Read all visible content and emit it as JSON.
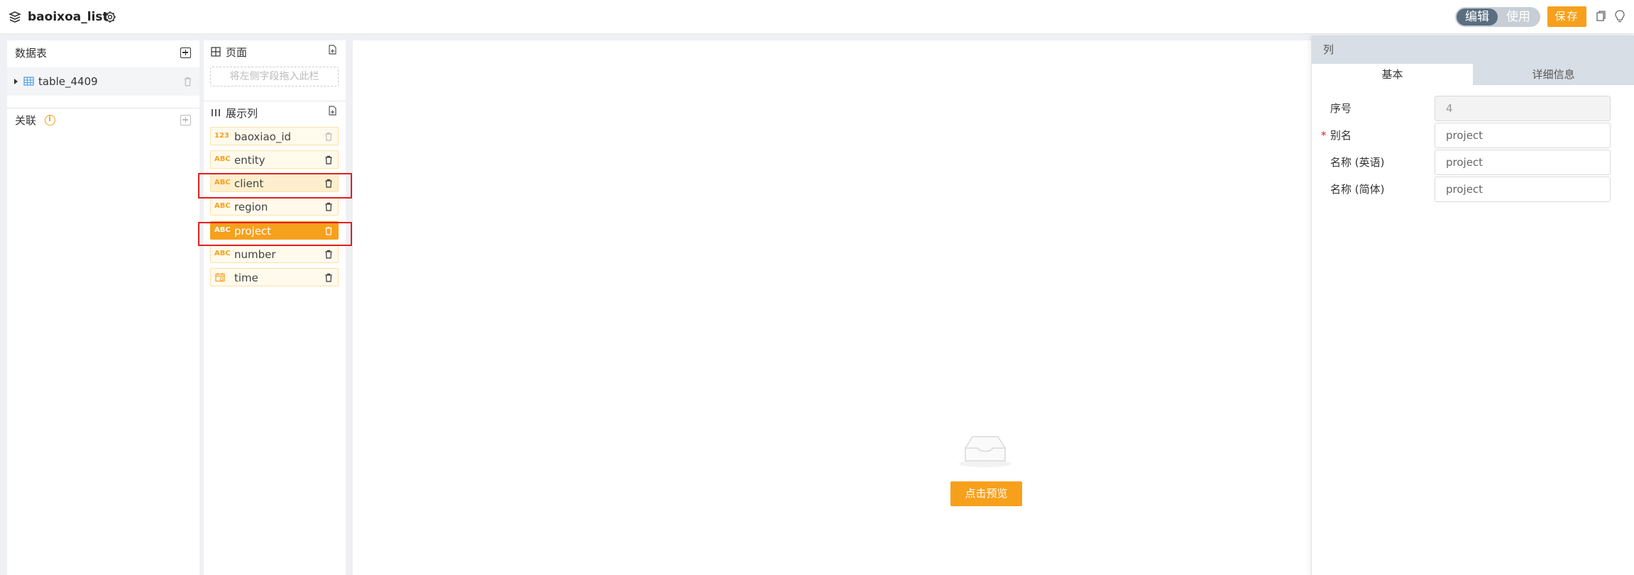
{
  "header": {
    "title": "baoixoa_list",
    "mode_edit": "编辑",
    "mode_use": "使用",
    "save_label": "保存"
  },
  "datasource": {
    "section_title": "数据表",
    "table_name": "table_4409",
    "relation_title": "关联"
  },
  "page_section": {
    "title": "页面",
    "drop_placeholder": "将左侧字段拖入此栏"
  },
  "display_section": {
    "title": "展示列",
    "fields": [
      {
        "type": "123",
        "name": "baoxiao_id",
        "state": "normal"
      },
      {
        "type": "ABC",
        "name": "entity",
        "state": "normal"
      },
      {
        "type": "ABC",
        "name": "client",
        "state": "hover"
      },
      {
        "type": "ABC",
        "name": "region",
        "state": "normal"
      },
      {
        "type": "ABC",
        "name": "project",
        "state": "selected"
      },
      {
        "type": "ABC",
        "name": "number",
        "state": "normal"
      },
      {
        "type": "date",
        "name": "time",
        "state": "normal"
      }
    ]
  },
  "preview": {
    "button_label": "点击预览"
  },
  "properties": {
    "header": "列",
    "tab_basic": "基本",
    "tab_detail": "详细信息",
    "fields": {
      "index_label": "序号",
      "index_value": "4",
      "alias_label": "别名",
      "alias_value": "project",
      "name_en_label": "名称 (英语)",
      "name_en_value": "project",
      "name_zh_label": "名称 (简体)",
      "name_zh_value": "project"
    }
  },
  "colors": {
    "accent": "#f7a01c",
    "highlight": "#e02020",
    "toggle_active": "#5a6e80"
  }
}
